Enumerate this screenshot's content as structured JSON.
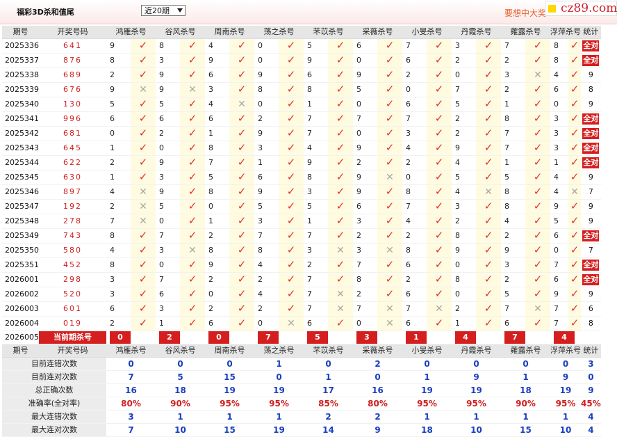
{
  "header": {
    "title": "福彩3D杀和值尾",
    "period_select": "近20期",
    "tip": "要想中大奖",
    "logo": "cz89.com"
  },
  "columns": [
    "期号",
    "开奖号码",
    "鸿雁杀号",
    "谷风杀号",
    "周南杀号",
    "荡之杀号",
    "芣苡杀号",
    "采薇杀号",
    "小旻杀号",
    "丹霞杀号",
    "蕹露杀号",
    "浮萍杀号",
    "统计"
  ],
  "all_correct_label": "全对",
  "rows": [
    {
      "issue": "2025336",
      "draw": "641",
      "kills": [
        [
          "9",
          "y"
        ],
        [
          "8",
          "y"
        ],
        [
          "4",
          "y"
        ],
        [
          "0",
          "y"
        ],
        [
          "5",
          "y"
        ],
        [
          "6",
          "y"
        ],
        [
          "7",
          "y"
        ],
        [
          "3",
          "y"
        ],
        [
          "7",
          "y"
        ],
        [
          "8",
          "y"
        ]
      ],
      "stat": "全对"
    },
    {
      "issue": "2025337",
      "draw": "876",
      "kills": [
        [
          "8",
          "y"
        ],
        [
          "3",
          "y"
        ],
        [
          "9",
          "y"
        ],
        [
          "0",
          "y"
        ],
        [
          "9",
          "y"
        ],
        [
          "0",
          "y"
        ],
        [
          "6",
          "y"
        ],
        [
          "2",
          "y"
        ],
        [
          "2",
          "y"
        ],
        [
          "8",
          "y"
        ]
      ],
      "stat": "全对"
    },
    {
      "issue": "2025338",
      "draw": "689",
      "kills": [
        [
          "2",
          "y"
        ],
        [
          "9",
          "y"
        ],
        [
          "6",
          "y"
        ],
        [
          "9",
          "y"
        ],
        [
          "6",
          "y"
        ],
        [
          "9",
          "y"
        ],
        [
          "2",
          "y"
        ],
        [
          "0",
          "y"
        ],
        [
          "3",
          "n"
        ],
        [
          "4",
          "y"
        ]
      ],
      "stat": "9"
    },
    {
      "issue": "2025339",
      "draw": "676",
      "kills": [
        [
          "9",
          "n"
        ],
        [
          "9",
          "n"
        ],
        [
          "3",
          "y"
        ],
        [
          "8",
          "y"
        ],
        [
          "8",
          "y"
        ],
        [
          "5",
          "y"
        ],
        [
          "0",
          "y"
        ],
        [
          "7",
          "y"
        ],
        [
          "2",
          "y"
        ],
        [
          "6",
          "y"
        ]
      ],
      "stat": "8"
    },
    {
      "issue": "2025340",
      "draw": "130",
      "kills": [
        [
          "5",
          "y"
        ],
        [
          "5",
          "y"
        ],
        [
          "4",
          "n"
        ],
        [
          "0",
          "y"
        ],
        [
          "1",
          "y"
        ],
        [
          "0",
          "y"
        ],
        [
          "6",
          "y"
        ],
        [
          "5",
          "y"
        ],
        [
          "1",
          "y"
        ],
        [
          "0",
          "y"
        ]
      ],
      "stat": "9"
    },
    {
      "issue": "2025341",
      "draw": "996",
      "kills": [
        [
          "6",
          "y"
        ],
        [
          "6",
          "y"
        ],
        [
          "6",
          "y"
        ],
        [
          "2",
          "y"
        ],
        [
          "7",
          "y"
        ],
        [
          "7",
          "y"
        ],
        [
          "7",
          "y"
        ],
        [
          "2",
          "y"
        ],
        [
          "8",
          "y"
        ],
        [
          "3",
          "y"
        ]
      ],
      "stat": "全对"
    },
    {
      "issue": "2025342",
      "draw": "681",
      "kills": [
        [
          "0",
          "y"
        ],
        [
          "2",
          "y"
        ],
        [
          "1",
          "y"
        ],
        [
          "9",
          "y"
        ],
        [
          "7",
          "y"
        ],
        [
          "0",
          "y"
        ],
        [
          "3",
          "y"
        ],
        [
          "2",
          "y"
        ],
        [
          "7",
          "y"
        ],
        [
          "3",
          "y"
        ]
      ],
      "stat": "全对"
    },
    {
      "issue": "2025343",
      "draw": "645",
      "kills": [
        [
          "1",
          "y"
        ],
        [
          "0",
          "y"
        ],
        [
          "8",
          "y"
        ],
        [
          "3",
          "y"
        ],
        [
          "4",
          "y"
        ],
        [
          "9",
          "y"
        ],
        [
          "4",
          "y"
        ],
        [
          "9",
          "y"
        ],
        [
          "7",
          "y"
        ],
        [
          "3",
          "y"
        ]
      ],
      "stat": "全对"
    },
    {
      "issue": "2025344",
      "draw": "622",
      "kills": [
        [
          "2",
          "y"
        ],
        [
          "9",
          "y"
        ],
        [
          "7",
          "y"
        ],
        [
          "1",
          "y"
        ],
        [
          "9",
          "y"
        ],
        [
          "2",
          "y"
        ],
        [
          "2",
          "y"
        ],
        [
          "4",
          "y"
        ],
        [
          "1",
          "y"
        ],
        [
          "1",
          "y"
        ]
      ],
      "stat": "全对"
    },
    {
      "issue": "2025345",
      "draw": "630",
      "kills": [
        [
          "1",
          "y"
        ],
        [
          "3",
          "y"
        ],
        [
          "5",
          "y"
        ],
        [
          "6",
          "y"
        ],
        [
          "8",
          "y"
        ],
        [
          "9",
          "n"
        ],
        [
          "0",
          "y"
        ],
        [
          "5",
          "y"
        ],
        [
          "5",
          "y"
        ],
        [
          "4",
          "y"
        ]
      ],
      "stat": "9"
    },
    {
      "issue": "2025346",
      "draw": "897",
      "kills": [
        [
          "4",
          "n"
        ],
        [
          "9",
          "y"
        ],
        [
          "8",
          "y"
        ],
        [
          "9",
          "y"
        ],
        [
          "3",
          "y"
        ],
        [
          "9",
          "y"
        ],
        [
          "8",
          "y"
        ],
        [
          "4",
          "n"
        ],
        [
          "8",
          "y"
        ],
        [
          "4",
          "n"
        ]
      ],
      "stat": "7"
    },
    {
      "issue": "2025347",
      "draw": "192",
      "kills": [
        [
          "2",
          "n"
        ],
        [
          "5",
          "y"
        ],
        [
          "0",
          "y"
        ],
        [
          "5",
          "y"
        ],
        [
          "5",
          "y"
        ],
        [
          "6",
          "y"
        ],
        [
          "7",
          "y"
        ],
        [
          "3",
          "y"
        ],
        [
          "8",
          "y"
        ],
        [
          "9",
          "y"
        ]
      ],
      "stat": "9"
    },
    {
      "issue": "2025348",
      "draw": "278",
      "kills": [
        [
          "7",
          "n"
        ],
        [
          "0",
          "y"
        ],
        [
          "1",
          "y"
        ],
        [
          "3",
          "y"
        ],
        [
          "1",
          "y"
        ],
        [
          "3",
          "y"
        ],
        [
          "4",
          "y"
        ],
        [
          "2",
          "y"
        ],
        [
          "4",
          "y"
        ],
        [
          "5",
          "y"
        ]
      ],
      "stat": "9"
    },
    {
      "issue": "2025349",
      "draw": "743",
      "kills": [
        [
          "8",
          "y"
        ],
        [
          "7",
          "y"
        ],
        [
          "2",
          "y"
        ],
        [
          "7",
          "y"
        ],
        [
          "7",
          "y"
        ],
        [
          "2",
          "y"
        ],
        [
          "2",
          "y"
        ],
        [
          "8",
          "y"
        ],
        [
          "2",
          "y"
        ],
        [
          "6",
          "y"
        ]
      ],
      "stat": "全对"
    },
    {
      "issue": "2025350",
      "draw": "580",
      "kills": [
        [
          "4",
          "y"
        ],
        [
          "3",
          "n"
        ],
        [
          "8",
          "y"
        ],
        [
          "8",
          "y"
        ],
        [
          "3",
          "n"
        ],
        [
          "3",
          "n"
        ],
        [
          "8",
          "y"
        ],
        [
          "9",
          "y"
        ],
        [
          "9",
          "y"
        ],
        [
          "0",
          "y"
        ]
      ],
      "stat": "7"
    },
    {
      "issue": "2025351",
      "draw": "452",
      "kills": [
        [
          "8",
          "y"
        ],
        [
          "0",
          "y"
        ],
        [
          "9",
          "y"
        ],
        [
          "4",
          "y"
        ],
        [
          "2",
          "y"
        ],
        [
          "7",
          "y"
        ],
        [
          "6",
          "y"
        ],
        [
          "0",
          "y"
        ],
        [
          "3",
          "y"
        ],
        [
          "7",
          "y"
        ]
      ],
      "stat": "全对"
    },
    {
      "issue": "2026001",
      "draw": "298",
      "kills": [
        [
          "3",
          "y"
        ],
        [
          "7",
          "y"
        ],
        [
          "2",
          "y"
        ],
        [
          "2",
          "y"
        ],
        [
          "7",
          "y"
        ],
        [
          "8",
          "y"
        ],
        [
          "2",
          "y"
        ],
        [
          "8",
          "y"
        ],
        [
          "2",
          "y"
        ],
        [
          "6",
          "y"
        ]
      ],
      "stat": "全对"
    },
    {
      "issue": "2026002",
      "draw": "520",
      "kills": [
        [
          "3",
          "y"
        ],
        [
          "6",
          "y"
        ],
        [
          "0",
          "y"
        ],
        [
          "4",
          "y"
        ],
        [
          "7",
          "n"
        ],
        [
          "2",
          "y"
        ],
        [
          "6",
          "y"
        ],
        [
          "0",
          "y"
        ],
        [
          "5",
          "y"
        ],
        [
          "9",
          "y"
        ]
      ],
      "stat": "9"
    },
    {
      "issue": "2026003",
      "draw": "601",
      "kills": [
        [
          "6",
          "y"
        ],
        [
          "3",
          "y"
        ],
        [
          "2",
          "y"
        ],
        [
          "2",
          "y"
        ],
        [
          "7",
          "n"
        ],
        [
          "7",
          "n"
        ],
        [
          "7",
          "n"
        ],
        [
          "2",
          "y"
        ],
        [
          "7",
          "n"
        ],
        [
          "7",
          "y"
        ]
      ],
      "stat": "6"
    },
    {
      "issue": "2026004",
      "draw": "019",
      "kills": [
        [
          "2",
          "y"
        ],
        [
          "1",
          "y"
        ],
        [
          "6",
          "y"
        ],
        [
          "0",
          "n"
        ],
        [
          "6",
          "y"
        ],
        [
          "0",
          "n"
        ],
        [
          "6",
          "y"
        ],
        [
          "1",
          "y"
        ],
        [
          "6",
          "y"
        ],
        [
          "7",
          "y"
        ]
      ],
      "stat": "8"
    }
  ],
  "current": {
    "issue": "2026005",
    "label": "当前期杀号",
    "kills": [
      "0",
      "2",
      "0",
      "7",
      "5",
      "3",
      "1",
      "4",
      "7",
      "4"
    ]
  },
  "stats": [
    {
      "label": "目前连错次数",
      "values": [
        "0",
        "0",
        "0",
        "1",
        "0",
        "2",
        "0",
        "0",
        "0",
        "0",
        "3"
      ],
      "red": false
    },
    {
      "label": "目前连对次数",
      "values": [
        "7",
        "5",
        "15",
        "0",
        "1",
        "0",
        "1",
        "9",
        "1",
        "9",
        "0"
      ],
      "red": false
    },
    {
      "label": "总正确次数",
      "values": [
        "16",
        "18",
        "19",
        "19",
        "17",
        "16",
        "19",
        "19",
        "18",
        "19",
        "9"
      ],
      "red": false
    },
    {
      "label": "准确率(全对率)",
      "values": [
        "80%",
        "90%",
        "95%",
        "95%",
        "85%",
        "80%",
        "95%",
        "95%",
        "90%",
        "95%",
        "45%"
      ],
      "red": true
    },
    {
      "label": "最大连错次数",
      "values": [
        "3",
        "1",
        "1",
        "1",
        "2",
        "2",
        "1",
        "1",
        "1",
        "1",
        "4"
      ],
      "red": false
    },
    {
      "label": "最大连对次数",
      "values": [
        "7",
        "10",
        "15",
        "19",
        "14",
        "9",
        "18",
        "10",
        "15",
        "10",
        "4"
      ],
      "red": false
    }
  ]
}
